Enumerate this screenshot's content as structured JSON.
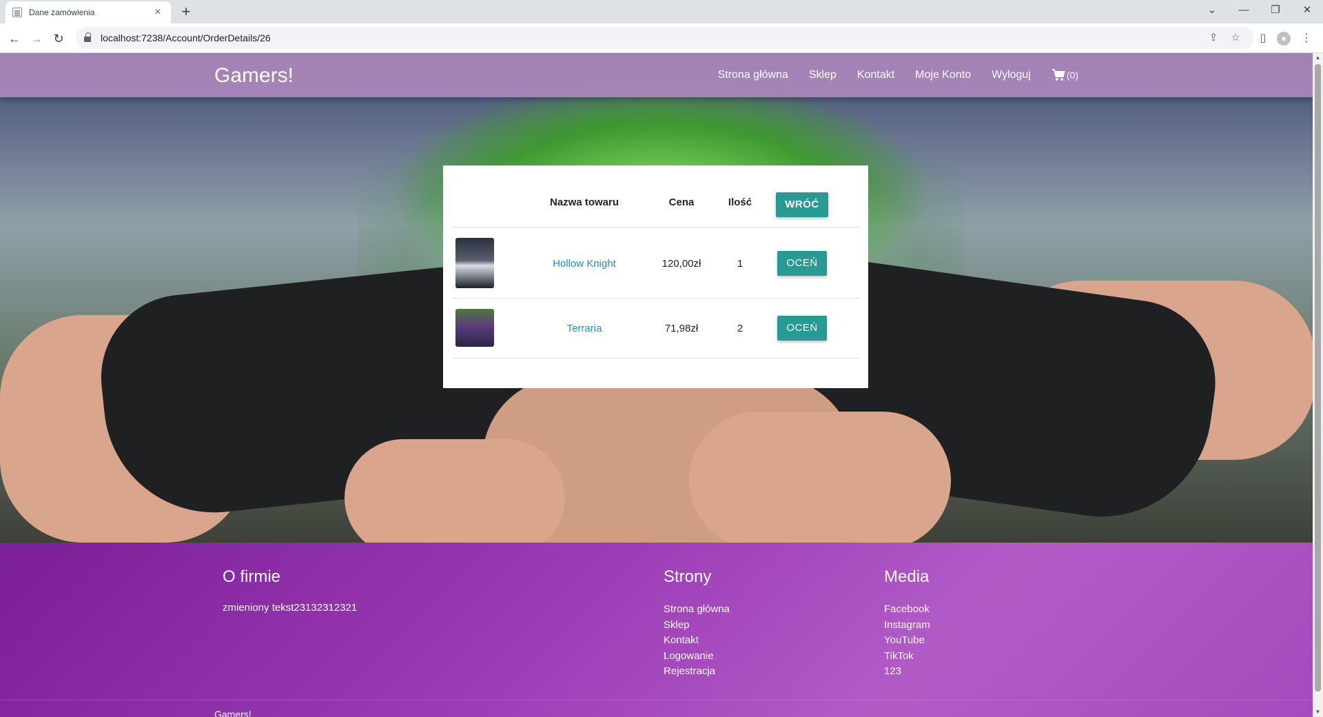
{
  "browser": {
    "tab_title": "Dane zamówienia",
    "tab_close": "×",
    "new_tab": "+",
    "url": "localhost:7238/Account/OrderDetails/26",
    "controls": {
      "minimize": "—",
      "restore": "❐",
      "close": "✕",
      "chevron": "⌄"
    }
  },
  "navbar": {
    "brand": "Gamers!",
    "links": [
      "Strona główna",
      "Sklep",
      "Kontakt",
      "Moje Konto",
      "Wyloguj"
    ],
    "cart_count": "(0)"
  },
  "order": {
    "headers": {
      "name": "Nazwa towaru",
      "price": "Cena",
      "qty": "Ilość"
    },
    "back_button": "WRÓĆ",
    "rate_button": "OCEŃ",
    "items": [
      {
        "name": "Hollow Knight",
        "price": "120,00zł",
        "qty": "1"
      },
      {
        "name": "Terraria",
        "price": "71,98zł",
        "qty": "2"
      }
    ]
  },
  "footer": {
    "about": {
      "title": "O firmie",
      "text": "zmieniony tekst23132312321"
    },
    "pages": {
      "title": "Strony",
      "items": [
        "Strona główna",
        "Sklep",
        "Kontakt",
        "Logowanie",
        "Rejestracja"
      ]
    },
    "media": {
      "title": "Media",
      "items": [
        "Facebook",
        "Instagram",
        "YouTube",
        "TikTok",
        "123"
      ]
    },
    "bottom_brand": "Gamers!"
  },
  "colors": {
    "accent_button": "#279b93",
    "link": "#1f8fcf",
    "navbar": "#b08abe",
    "footer": "#9a3ab5"
  }
}
